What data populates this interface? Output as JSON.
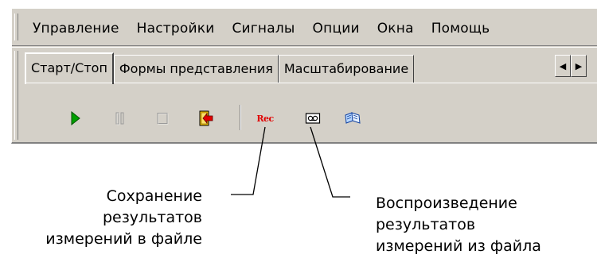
{
  "menu": {
    "items": [
      "Управление",
      "Настройки",
      "Сигналы",
      "Опции",
      "Окна",
      "Помощь"
    ]
  },
  "tabs": [
    {
      "label": "Старт/Стоп",
      "active": true
    },
    {
      "label": "Формы представления",
      "active": false
    },
    {
      "label": "Масштабирование",
      "active": false
    }
  ],
  "toolbar": {
    "buttons": [
      {
        "name": "play-icon",
        "enabled": true
      },
      {
        "name": "pause-icon",
        "enabled": false
      },
      {
        "name": "stop-icon",
        "enabled": false
      },
      {
        "name": "exit-icon",
        "enabled": true
      },
      {
        "name": "record-icon",
        "enabled": true,
        "label": "Rec"
      },
      {
        "name": "tape-playback-icon",
        "enabled": true
      },
      {
        "name": "open-book-icon",
        "enabled": true
      }
    ]
  },
  "callouts": {
    "save": [
      "Сохранение",
      "результатов",
      "измерений в файле"
    ],
    "playback": [
      "Воспроизведение",
      "результатов",
      "измерений из файла"
    ]
  },
  "colors": {
    "face": "#d4d0c8",
    "play": "#00a000",
    "record": "#e00000",
    "exit": "#f2c200"
  }
}
